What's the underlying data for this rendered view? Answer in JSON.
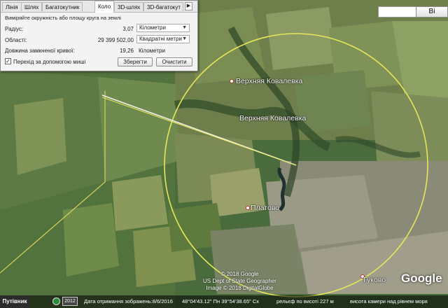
{
  "dialog": {
    "tabs": [
      "Лінія",
      "Шлях",
      "Багатокутник",
      "Коло",
      "3D-шлях",
      "3D-багатокут"
    ],
    "active_tab": "Коло",
    "scroll_arrow": "▶",
    "instruction": "Виміряйте окружність або площу круга на землі",
    "radius_label": "Радіус:",
    "radius_value": "3,07",
    "radius_unit": "Кілометри",
    "area_label": "Області:",
    "area_value": "29 399 502,00",
    "area_unit": "Квадратні метри",
    "perimeter_label": "Довжина замкненої кривої:",
    "perimeter_value": "19,26",
    "perimeter_unit": "Кілометри",
    "mouse_nav_label": "Перехід за допомогою миші",
    "mouse_nav_checked": true,
    "save_button": "Зберегти",
    "clear_button": "Очистити"
  },
  "search_button": "Ві",
  "map": {
    "places": [
      {
        "name": "Верхняя Ковалевка",
        "pin": true
      },
      {
        "name": "Верхняя Ковалевка",
        "pin": false
      },
      {
        "name": "Платово",
        "pin": true
      },
      {
        "name": "Гуково",
        "pin": true
      }
    ],
    "copyright": [
      "© 2018 Google",
      "US Dept of State Geographer",
      "Image © 2018 DigitalGlobe"
    ],
    "logo": "Google",
    "circle_color": "#e6e65a",
    "border_color": "#d6d25a"
  },
  "status_bar": {
    "start_label": "Путівник",
    "year_badge": "2012",
    "image_date": "Дата отримання зображень:8/6/2016",
    "coords": "48°04'43.12\" Пн    39°54'38.65\" Сх",
    "elevation": "рельєф по висоті  227 м",
    "eye_alt": "висота камери над рівнем моря"
  }
}
